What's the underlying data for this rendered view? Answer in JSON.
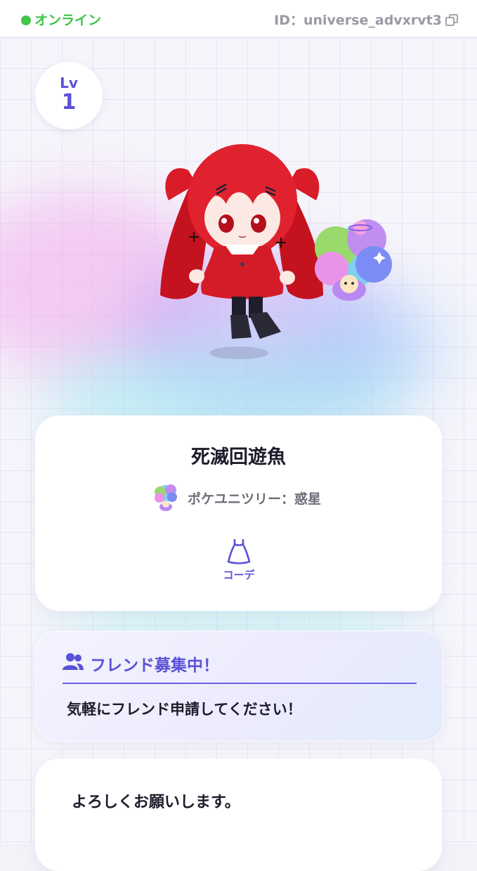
{
  "status": {
    "text": "オンライン",
    "color": "#3fc64b"
  },
  "user": {
    "id_text": "ID：universe_advxrvt3",
    "level_label": "Lv",
    "level_value": "1",
    "name": "死滅回遊魚",
    "poke_tree": "ポケユニツリー：惑星"
  },
  "actions": {
    "coord_label": "コーデ"
  },
  "friend": {
    "title": "フレンド募集中！",
    "message": "気軽にフレンド申請してください！"
  },
  "bio": {
    "text": "よろしくお願いします。"
  },
  "theme": {
    "accent": "#5a52d6",
    "text_muted": "#9a9aa6"
  },
  "icons": {
    "copy": "copy-icon",
    "dress": "dress-icon",
    "friends": "friends-icon",
    "tree": "planet-tree-icon"
  }
}
